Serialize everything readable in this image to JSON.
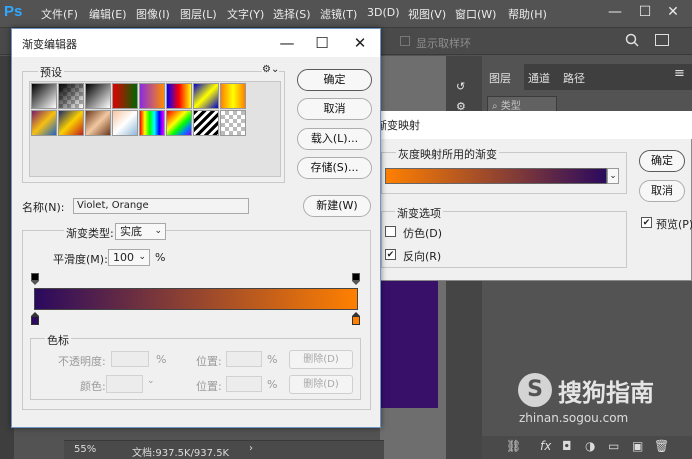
{
  "app": {
    "logo": "Ps",
    "menu": [
      "文件(F)",
      "编辑(E)",
      "图像(I)",
      "图层(L)",
      "文字(Y)",
      "选择(S)",
      "滤镜(T)",
      "3D(D)",
      "视图(V)",
      "窗口(W)",
      "帮助(H)"
    ],
    "window_controls": [
      "—",
      "☐",
      "✕"
    ],
    "options_bar": {
      "show_sampling_ring": "显示取样环"
    },
    "doc_status": {
      "zoom": "55%",
      "doc_size": "文档:937.5K/937.5K"
    }
  },
  "layers_panel": {
    "tabs": [
      "图层",
      "通道",
      "路径"
    ],
    "filter_label": "类型"
  },
  "gradient_map": {
    "title": "渐变映射",
    "group_gradient": "灰度映射所用的渐变",
    "ok": "确定",
    "cancel": "取消",
    "preview_label": "预览(P)",
    "preview_checked": true,
    "options_group": "渐变选项",
    "dither_label": "仿色(D)",
    "dither_checked": false,
    "reverse_label": "反向(R)",
    "reverse_checked": true,
    "gradient_colors": [
      "#ff8000",
      "#2a0a5e"
    ]
  },
  "gradient_editor": {
    "title": "渐变编辑器",
    "presets_label": "预设",
    "buttons": {
      "ok": "确定",
      "cancel": "取消",
      "load": "载入(L)...",
      "save": "存储(S)...",
      "new": "新建(W)"
    },
    "name_label": "名称(N):",
    "name_value": "Violet, Orange",
    "type_label": "渐变类型:",
    "type_value": "实底",
    "smoothness_label": "平滑度(M):",
    "smoothness_value": "100",
    "percent": "%",
    "gradient_colors": [
      "#2a0a5e",
      "#ff8000"
    ],
    "stops_group": "色标",
    "opacity_label": "不透明度:",
    "location_label": "位置:",
    "delete_label": "删除(D)",
    "color_label": "颜色:",
    "presets": [
      "linear-gradient(135deg,#000,#fff)",
      "checker-fg",
      "linear-gradient(135deg,#000,#fff)",
      "linear-gradient(90deg,#e00000,#006600)",
      "linear-gradient(90deg,#8a2be2,#ff8c00)",
      "linear-gradient(90deg,#0000ff,#ff0000,#ffff00)",
      "linear-gradient(135deg,#0000cc,#ffff00,#0000cc)",
      "linear-gradient(90deg,#ff8000,#ffff00,#ff8000)",
      "linear-gradient(135deg,#7a1b6a,#f7c012,#1a64c8)",
      "linear-gradient(135deg,#1b2a6b,#fbd000,#c01c1c)",
      "linear-gradient(135deg,#6b3a1f,#f2c7a0,#6b3a1f)",
      "linear-gradient(135deg,#f7c3a0,#ffffff,#8fb6d9)",
      "linear-gradient(90deg,#ff0000,#ffff00,#00ff00,#00ffff,#0000ff,#ff00ff)",
      "linear-gradient(135deg,#ff0000,#ff8000,#ffff00,#00ff00,#0080ff,#8000ff)",
      "repeating-linear-gradient(135deg,#000 0 3px,#fff 3px 6px)",
      "checker"
    ]
  },
  "watermark": {
    "logo": "S",
    "name": "搜狗指南",
    "url": "zhinan.sogou.com"
  }
}
